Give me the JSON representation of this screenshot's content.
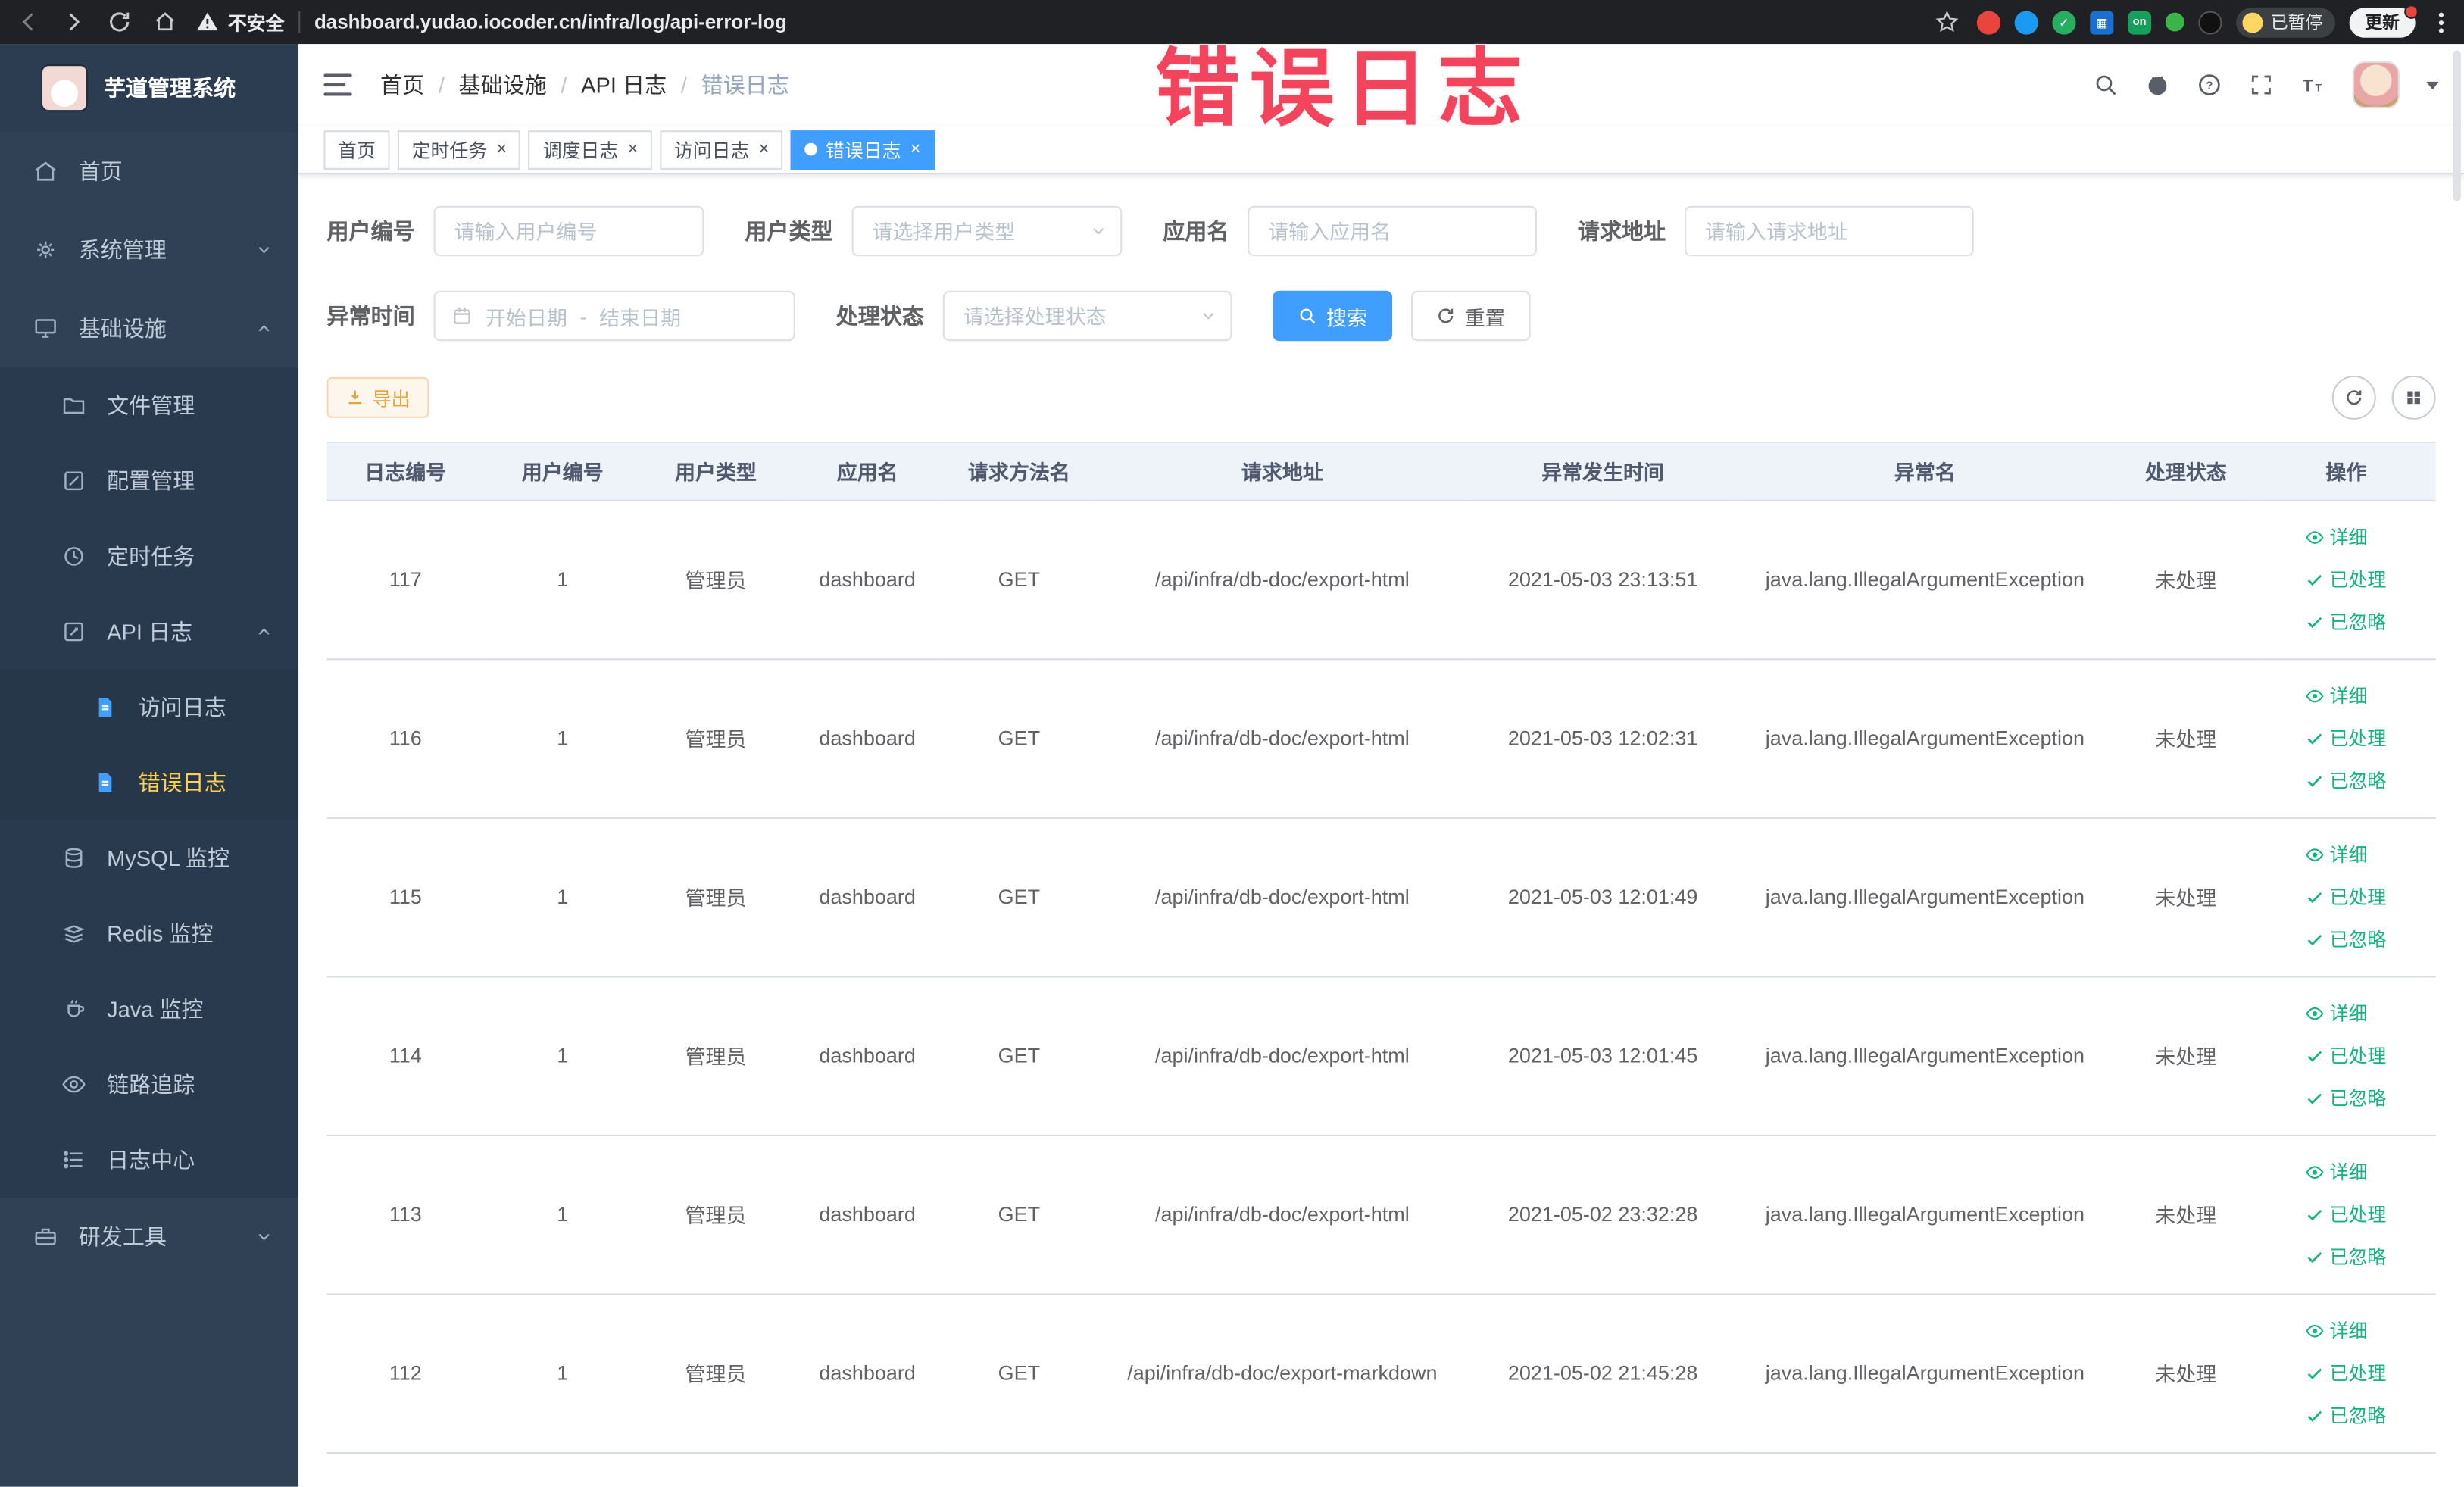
{
  "browser": {
    "security_label": "不安全",
    "url": "dashboard.yudao.iocoder.cn/infra/log/api-error-log",
    "extensions": {
      "on_badge": "on"
    },
    "paused_label": "已暂停",
    "update_label": "更新"
  },
  "annotation": {
    "text": "错误日志"
  },
  "sidebar": {
    "logo_title": "芋道管理系统",
    "items": [
      {
        "label": "首页"
      },
      {
        "label": "系统管理"
      },
      {
        "label": "基础设施"
      },
      {
        "label": "文件管理"
      },
      {
        "label": "配置管理"
      },
      {
        "label": "定时任务"
      },
      {
        "label": "API 日志"
      },
      {
        "label": "访问日志"
      },
      {
        "label": "错误日志",
        "active": true
      },
      {
        "label": "MySQL 监控"
      },
      {
        "label": "Redis 监控"
      },
      {
        "label": "Java 监控"
      },
      {
        "label": "链路追踪"
      },
      {
        "label": "日志中心"
      },
      {
        "label": "研发工具"
      }
    ]
  },
  "header": {
    "breadcrumb": [
      "首页",
      "基础设施",
      "API 日志",
      "错误日志"
    ]
  },
  "tabs": [
    {
      "label": "首页",
      "closable": false,
      "active": false
    },
    {
      "label": "定时任务",
      "closable": true,
      "active": false
    },
    {
      "label": "调度日志",
      "closable": true,
      "active": false
    },
    {
      "label": "访问日志",
      "closable": true,
      "active": false
    },
    {
      "label": "错误日志",
      "closable": true,
      "active": true
    }
  ],
  "filters": {
    "user_id_label": "用户编号",
    "user_id_placeholder": "请输入用户编号",
    "user_type_label": "用户类型",
    "user_type_placeholder": "请选择用户类型",
    "app_name_label": "应用名",
    "app_name_placeholder": "请输入应用名",
    "request_url_label": "请求地址",
    "request_url_placeholder": "请输入请求地址",
    "exception_time_label": "异常时间",
    "start_date_placeholder": "开始日期",
    "range_separator": "-",
    "end_date_placeholder": "结束日期",
    "status_label": "处理状态",
    "status_placeholder": "请选择处理状态",
    "search_button": "搜索",
    "reset_button": "重置"
  },
  "toolbar": {
    "export_button": "导出"
  },
  "table": {
    "headers": [
      "日志编号",
      "用户编号",
      "用户类型",
      "应用名",
      "请求方法名",
      "请求地址",
      "异常发生时间",
      "异常名",
      "处理状态",
      "操作"
    ],
    "actions": [
      "详细",
      "已处理",
      "已忽略"
    ],
    "rows": [
      {
        "id": "117",
        "user_id": "1",
        "user_type": "管理员",
        "app": "dashboard",
        "method": "GET",
        "url": "/api/infra/db-doc/export-html",
        "time": "2021-05-03 23:13:51",
        "exception": "java.lang.IllegalArgumentException",
        "status": "未处理"
      },
      {
        "id": "116",
        "user_id": "1",
        "user_type": "管理员",
        "app": "dashboard",
        "method": "GET",
        "url": "/api/infra/db-doc/export-html",
        "time": "2021-05-03 12:02:31",
        "exception": "java.lang.IllegalArgumentException",
        "status": "未处理"
      },
      {
        "id": "115",
        "user_id": "1",
        "user_type": "管理员",
        "app": "dashboard",
        "method": "GET",
        "url": "/api/infra/db-doc/export-html",
        "time": "2021-05-03 12:01:49",
        "exception": "java.lang.IllegalArgumentException",
        "status": "未处理"
      },
      {
        "id": "114",
        "user_id": "1",
        "user_type": "管理员",
        "app": "dashboard",
        "method": "GET",
        "url": "/api/infra/db-doc/export-html",
        "time": "2021-05-03 12:01:45",
        "exception": "java.lang.IllegalArgumentException",
        "status": "未处理"
      },
      {
        "id": "113",
        "user_id": "1",
        "user_type": "管理员",
        "app": "dashboard",
        "method": "GET",
        "url": "/api/infra/db-doc/export-html",
        "time": "2021-05-02 23:32:28",
        "exception": "java.lang.IllegalArgumentException",
        "status": "未处理"
      },
      {
        "id": "112",
        "user_id": "1",
        "user_type": "管理员",
        "app": "dashboard",
        "method": "GET",
        "url": "/api/infra/db-doc/export-markdown",
        "time": "2021-05-02 21:45:28",
        "exception": "java.lang.IllegalArgumentException",
        "status": "未处理"
      }
    ]
  },
  "colors": {
    "accent": "#409eff",
    "action_link": "#15b37d",
    "warning": "#e6a23c",
    "sidebar_bg": "#304156",
    "active_menu_text": "#ffd04b",
    "annotation": "#f2455d",
    "tag_active": "#409eff"
  }
}
